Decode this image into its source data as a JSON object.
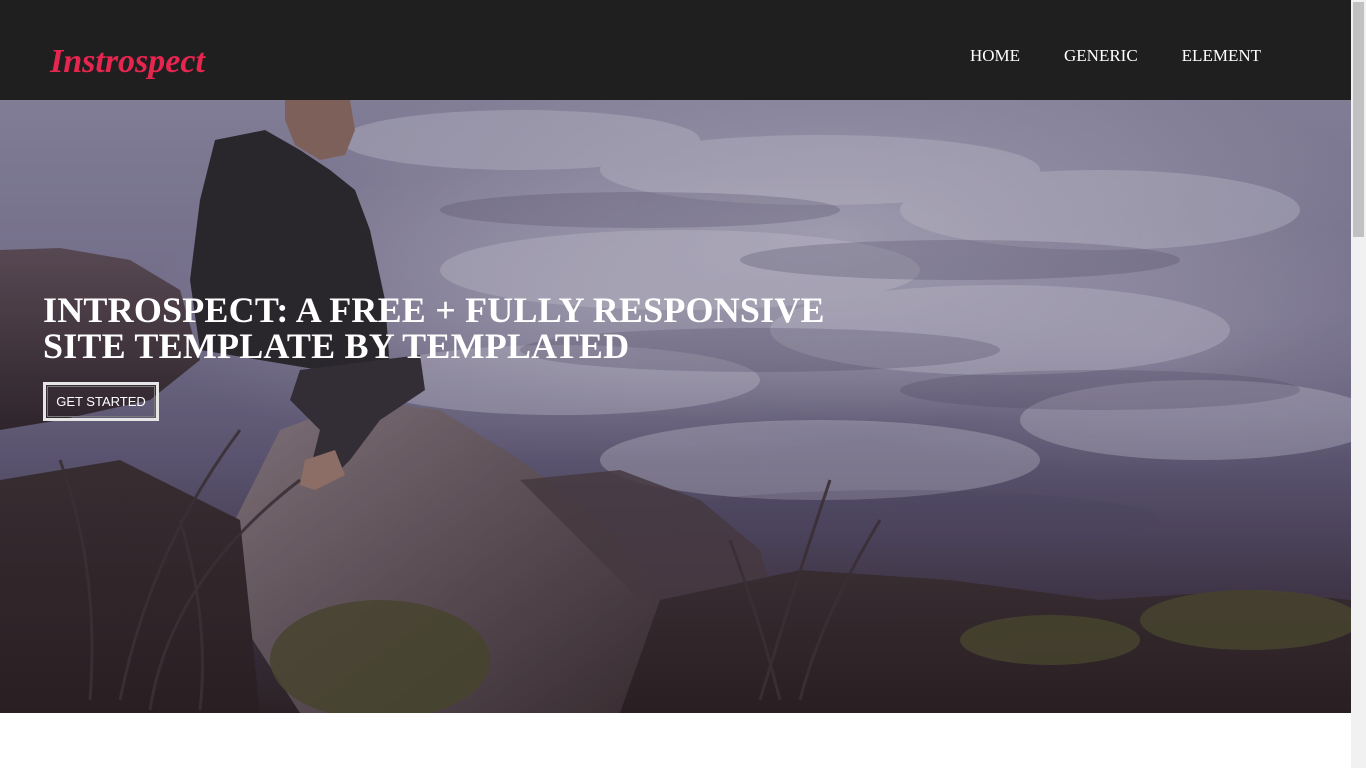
{
  "header": {
    "logo": "Instrospect",
    "nav": [
      {
        "label": "HOME"
      },
      {
        "label": "GENERIC"
      },
      {
        "label": "ELEMENT"
      }
    ]
  },
  "banner": {
    "title": "INTROSPECT: A FREE + FULLY RESPONSIVE SITE TEMPLATE BY TEMPLATED",
    "cta_label": "GET STARTED"
  },
  "colors": {
    "header_bg": "#1f1f1f",
    "logo": "#e8254f",
    "nav_text": "#ffffff"
  },
  "icons": {
    "scrollbar": "scrollbar-thumb"
  }
}
